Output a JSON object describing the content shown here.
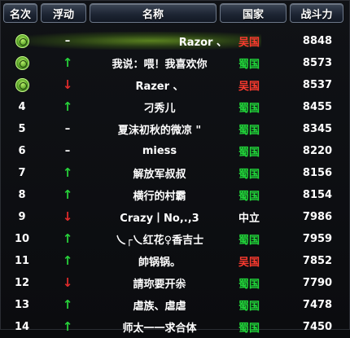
{
  "header": {
    "rank": "名次",
    "float": "浮动",
    "name": "名称",
    "country": "国家",
    "power": "战斗力"
  },
  "rows": [
    {
      "rank": "",
      "badge": "medal-icon",
      "float": "–",
      "float_type": "none",
      "name": "Razor 、",
      "country": "吴国",
      "country_color": "#ff3b2f",
      "power": "8848"
    },
    {
      "rank": "",
      "badge": "medal-icon",
      "float": "↑",
      "float_type": "up",
      "name": "我说：喂！我喜欢你",
      "country": "蜀国",
      "country_color": "#21d93a",
      "power": "8573"
    },
    {
      "rank": "",
      "badge": "medal-icon",
      "float": "↓",
      "float_type": "down",
      "name": "Razer 、",
      "country": "吴国",
      "country_color": "#ff3b2f",
      "power": "8537"
    },
    {
      "rank": "4",
      "float": "↑",
      "float_type": "up",
      "name": "刁秀儿",
      "country": "蜀国",
      "country_color": "#21d93a",
      "power": "8455"
    },
    {
      "rank": "5",
      "float": "–",
      "float_type": "none",
      "name": "夏沫初秋的微凉 \"",
      "country": "蜀国",
      "country_color": "#21d93a",
      "power": "8345"
    },
    {
      "rank": "6",
      "float": "–",
      "float_type": "none",
      "name": "miess",
      "country": "蜀国",
      "country_color": "#21d93a",
      "power": "8220"
    },
    {
      "rank": "7",
      "float": "↑",
      "float_type": "up",
      "name": "解放军叔叔",
      "country": "蜀国",
      "country_color": "#21d93a",
      "power": "8156"
    },
    {
      "rank": "8",
      "float": "↑",
      "float_type": "up",
      "name": "横行的村霸",
      "country": "蜀国",
      "country_color": "#21d93a",
      "power": "8154"
    },
    {
      "rank": "9",
      "float": "↓",
      "float_type": "down",
      "name": "Crazy丨No,.,3",
      "country": "中立",
      "country_color": "#ffffff",
      "power": "7986"
    },
    {
      "rank": "10",
      "float": "↑",
      "float_type": "up",
      "name": "乀┌乀红花♀香吉士",
      "country": "蜀国",
      "country_color": "#21d93a",
      "power": "7959"
    },
    {
      "rank": "11",
      "float": "↑",
      "float_type": "up",
      "name": "帥锅锅。",
      "country": "吴国",
      "country_color": "#ff3b2f",
      "power": "7852"
    },
    {
      "rank": "12",
      "float": "↓",
      "float_type": "down",
      "name": "請珎要开尜",
      "country": "蜀国",
      "country_color": "#21d93a",
      "power": "7790"
    },
    {
      "rank": "13",
      "float": "↑",
      "float_type": "up",
      "name": "虐族、虐虐",
      "country": "蜀国",
      "country_color": "#21d93a",
      "power": "7478"
    },
    {
      "rank": "14",
      "float": "↑",
      "float_type": "up",
      "name": "师太一一求合体",
      "country": "蜀国",
      "country_color": "#21d93a",
      "power": "7450"
    }
  ]
}
